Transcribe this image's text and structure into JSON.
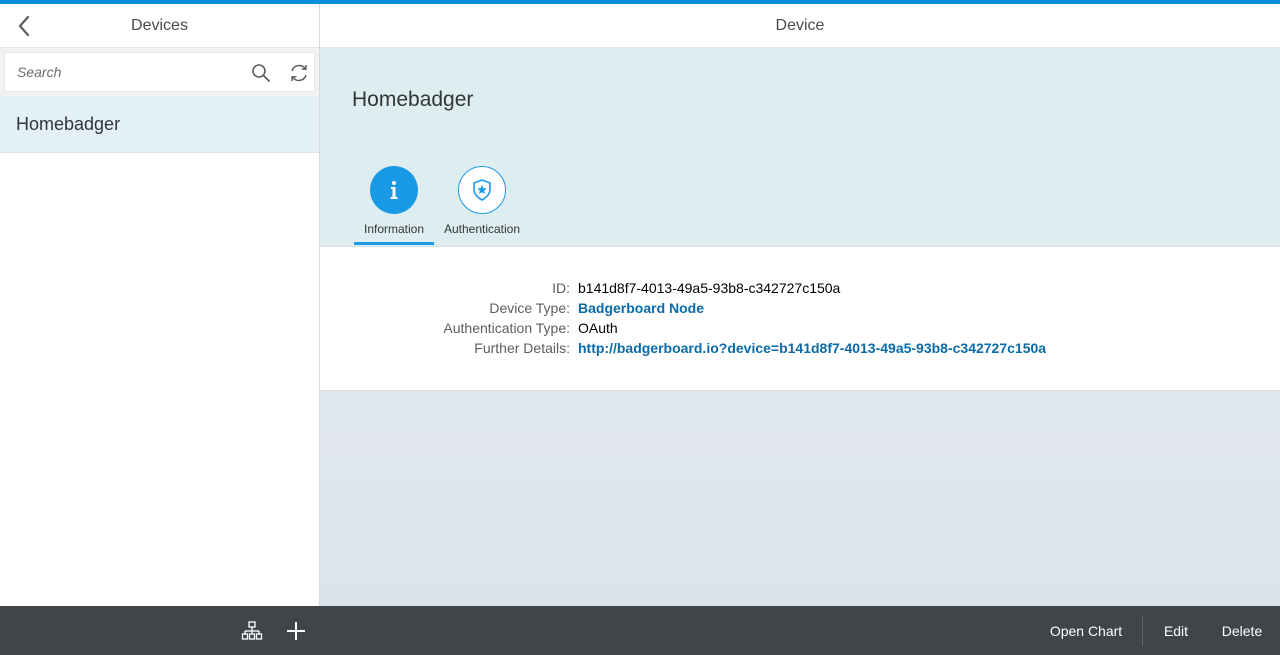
{
  "master": {
    "title": "Devices",
    "search_placeholder": "Search",
    "devices": [
      {
        "name": "Homebadger",
        "selected": true
      }
    ],
    "footer_icons": [
      "hierarchy-icon",
      "add-icon"
    ]
  },
  "detail": {
    "title": "Device",
    "object_title": "Homebadger",
    "tabs": [
      {
        "label": "Information",
        "icon": "info-icon",
        "selected": true
      },
      {
        "label": "Authentication",
        "icon": "shield-star-icon",
        "selected": false
      }
    ],
    "fields": [
      {
        "label": "ID:",
        "value": "b141d8f7-4013-49a5-93b8-c342727c150a",
        "link": false
      },
      {
        "label": "Device Type:",
        "value": "Badgerboard Node",
        "link": true
      },
      {
        "label": "Authentication Type:",
        "value": "OAuth",
        "link": false
      },
      {
        "label": "Further Details:",
        "value": "http://badgerboard.io?device=b141d8f7-4013-49a5-93b8-c342727c150a",
        "link": true
      }
    ],
    "footer": {
      "open_chart": "Open Chart",
      "edit": "Edit",
      "delete": "Delete"
    }
  },
  "colors": {
    "accent": "#0a8ee0",
    "footer_bg": "#3f4549",
    "link": "#0a6ba8",
    "header_bg": "#deedf0"
  }
}
